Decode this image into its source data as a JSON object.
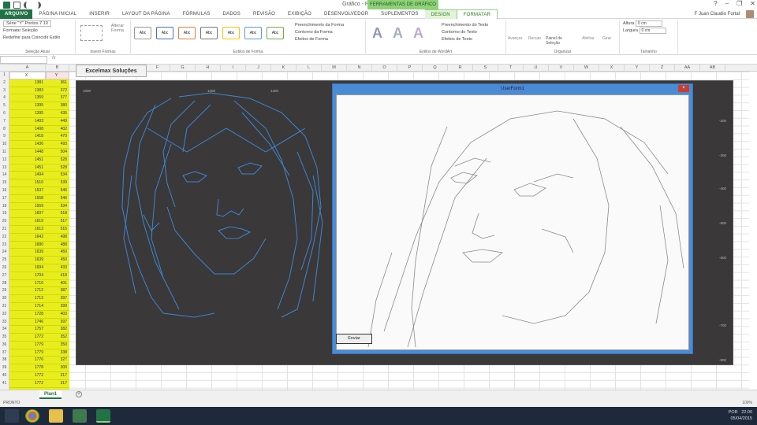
{
  "app": {
    "window_title": "Gráfico - Preparações - Excel",
    "contextual_group": "FERRAMENTAS DE GRÁFICO",
    "user_name": "F Juan Claudio Furtal"
  },
  "tabs": [
    {
      "label": "ARQUIVO",
      "kind": "file"
    },
    {
      "label": "PÁGINA INICIAL"
    },
    {
      "label": "INSERIR"
    },
    {
      "label": "LAYOUT DA PÁGINA"
    },
    {
      "label": "FÓRMULAS"
    },
    {
      "label": "DADOS"
    },
    {
      "label": "REVISÃO"
    },
    {
      "label": "EXIBIÇÃO"
    },
    {
      "label": "DESENVOLVEDOR"
    },
    {
      "label": "SUPLEMENTOS"
    },
    {
      "label": "DESIGN",
      "kind": "ctx"
    },
    {
      "label": "FORMATAR",
      "kind": "active-ctx"
    }
  ],
  "ribbon": {
    "selection_combo": "Série \"Y\" Pontos 7 10",
    "format_selection": "Formatar Seleção",
    "reset_style": "Redefinir para Coincidir Estilo",
    "group_current_selection": "Seleção Atual",
    "change_shape": "Alterar Forma",
    "group_insert_shapes": "Inserir Formas",
    "shape_style_label": "Abc",
    "shape_fill": "Preenchimento da Forma",
    "shape_outline": "Contorno da Forma",
    "shape_effects": "Efeitos de Forma",
    "group_shape_styles": "Estilos de Forma",
    "wordart_letter": "A",
    "text_fill": "Preenchimento do Texto",
    "text_outline": "Contorno do Texto",
    "text_effects": "Efeitos de Texto",
    "group_wordart": "Estilos de WordArt",
    "bring_forward": "Avançar",
    "send_backward": "Recuar",
    "selection_pane": "Painel de Seleção",
    "align": "Alinhar",
    "group": "Girar",
    "group_arrange": "Organizar",
    "height_label": "Altura",
    "height_value": "0 cm",
    "width_label": "Largura",
    "width_value": "0 cm",
    "group_size": "Tamanho"
  },
  "formula_bar": {
    "name_box": "",
    "fx": "fx"
  },
  "columns": [
    "A",
    "B",
    "C",
    "D",
    "E",
    "F",
    "G",
    "H",
    "I",
    "J",
    "K",
    "L",
    "M",
    "N",
    "O",
    "P",
    "Q",
    "R",
    "S",
    "T",
    "U",
    "V",
    "W",
    "X",
    "Y",
    "Z",
    "AA",
    "AB",
    "AC"
  ],
  "table": {
    "header_x": "X",
    "header_y": "Y",
    "rows": [
      [
        "1381",
        "361"
      ],
      [
        "1383",
        "372"
      ],
      [
        "1359",
        "377"
      ],
      [
        "1395",
        "380"
      ],
      [
        "1395",
        "435"
      ],
      [
        "1403",
        "449"
      ],
      [
        "1408",
        "402"
      ],
      [
        "1418",
        "470"
      ],
      [
        "1436",
        "493"
      ],
      [
        "1448",
        "504"
      ],
      [
        "1451",
        "528"
      ],
      [
        "1451",
        "528"
      ],
      [
        "1494",
        "534"
      ],
      [
        "1510",
        "539"
      ],
      [
        "1537",
        "546"
      ],
      [
        "1558",
        "546"
      ],
      [
        "1559",
        "534"
      ],
      [
        "1607",
        "518"
      ],
      [
        "1619",
        "517"
      ],
      [
        "1613",
        "515"
      ],
      [
        "1642",
        "498"
      ],
      [
        "1680",
        "488"
      ],
      [
        "1639",
        "450"
      ],
      [
        "1639",
        "450"
      ],
      [
        "1694",
        "433"
      ],
      [
        "1704",
        "418"
      ],
      [
        "1710",
        "401"
      ],
      [
        "1712",
        "387"
      ],
      [
        "1713",
        "397"
      ],
      [
        "1714",
        "399"
      ],
      [
        "1728",
        "403"
      ],
      [
        "1746",
        "397"
      ],
      [
        "1757",
        "382"
      ],
      [
        "1772",
        "352"
      ],
      [
        "1779",
        "350"
      ],
      [
        "1779",
        "338"
      ],
      [
        "1776",
        "327"
      ],
      [
        "1778",
        "300"
      ],
      [
        "1772",
        "317"
      ],
      [
        "1772",
        "317"
      ]
    ]
  },
  "excelmax_label": "Excelmax Soluções",
  "chart": {
    "x_ticks": [
      "1000",
      "1200",
      "1400"
    ],
    "y_ticks": [
      "-200",
      "-300",
      "-400",
      "-500",
      "-600",
      "-700",
      "-800"
    ]
  },
  "dialog": {
    "title": "UserForm1",
    "close": "×",
    "button": "Enviar"
  },
  "sheet": {
    "tab": "Plan1",
    "add": "+"
  },
  "status": {
    "left": "PRONTO",
    "zoom": "100%"
  },
  "taskbar": {
    "lang": "POR",
    "time": "22:00",
    "date": "05/04/2015"
  },
  "colors": {
    "excel_green": "#217346",
    "highlight_yellow": "#e8ee1e",
    "chart_bg": "#3a3838",
    "sketch_blue": "#3d8fe6"
  }
}
